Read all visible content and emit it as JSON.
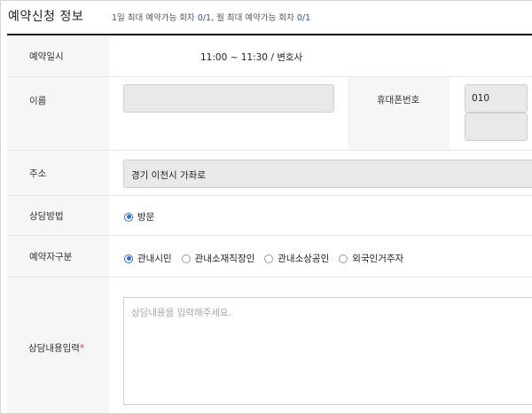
{
  "header": {
    "title": "예약신청 정보",
    "daily_prefix": "1일 최대 예약가능 회차 ",
    "daily_count": "0/1",
    "monthly_prefix": ", 월 최대 예약가능 회차 ",
    "monthly_count": "0/1"
  },
  "reservation": {
    "label": "예약일시",
    "value": "11:00 ~ 11:30 / 변호사"
  },
  "name": {
    "label": "이름",
    "value": ""
  },
  "phone": {
    "label": "휴대폰번호",
    "first": "010",
    "second": ""
  },
  "address": {
    "label": "주소",
    "value": "경기 이천시 가좌로"
  },
  "method": {
    "label": "상담방법",
    "options": [
      {
        "label": "방문",
        "selected": true
      }
    ]
  },
  "reserver_type": {
    "label": "예약자구분",
    "options": [
      {
        "label": "관내시민",
        "selected": true
      },
      {
        "label": "관내소재직장인",
        "selected": false
      },
      {
        "label": "관내소상공인",
        "selected": false
      },
      {
        "label": "외국인거주자",
        "selected": false
      }
    ]
  },
  "consult": {
    "label": "상담내용입력",
    "required_mark": "*",
    "placeholder": "상담내용을 입력해주세요."
  },
  "colors": {
    "accent": "#2f6fd6",
    "count": "#2a4fb0",
    "required": "#d23a3a",
    "label_bg": "#f6f6f6",
    "input_bg": "#e9e9e9"
  }
}
